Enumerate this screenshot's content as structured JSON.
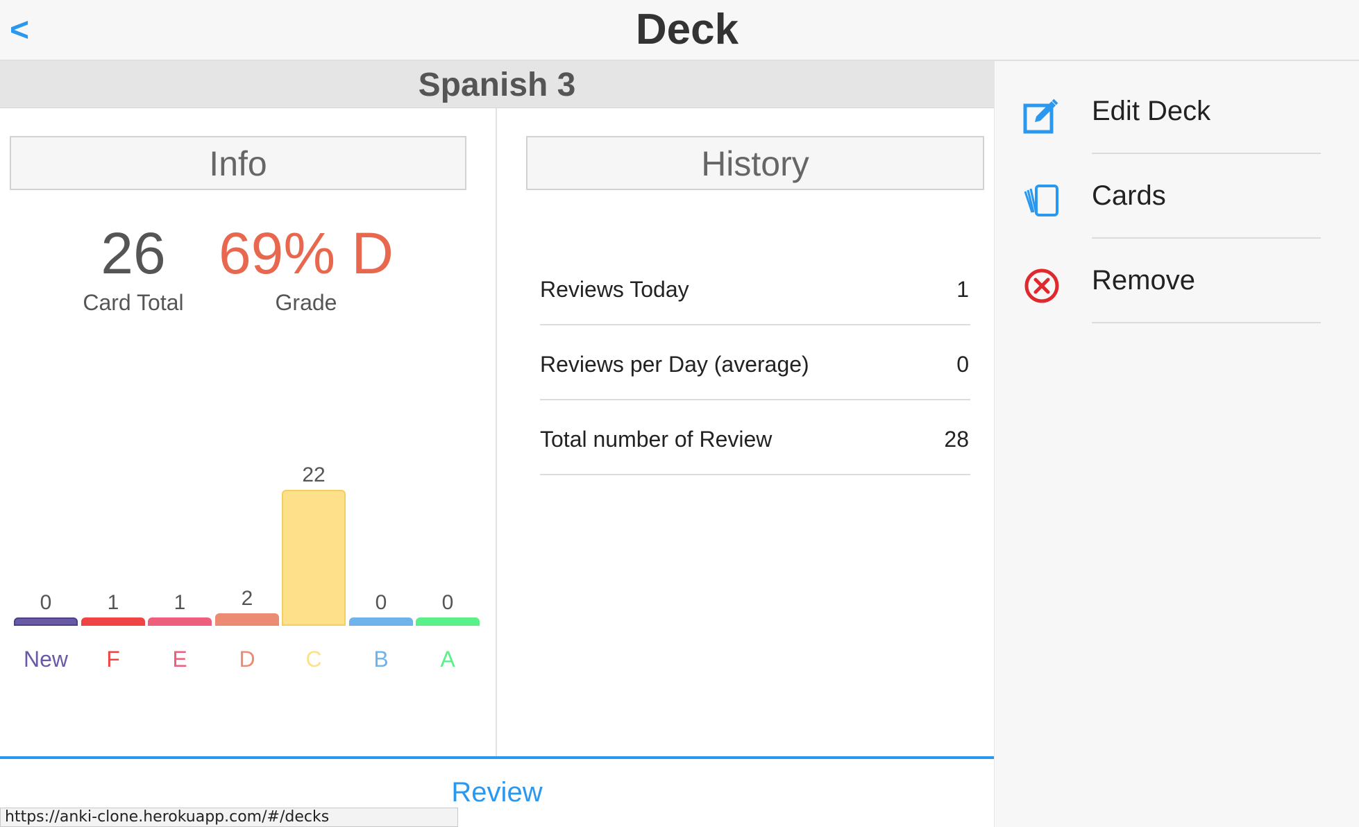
{
  "header": {
    "back_label": "<",
    "title": "Deck"
  },
  "deck": {
    "name": "Spanish 3"
  },
  "info": {
    "heading": "Info",
    "card_total_value": "26",
    "card_total_label": "Card Total",
    "grade_value": "69% D",
    "grade_label": "Grade",
    "grade_color": "#e8684f"
  },
  "chart_data": {
    "type": "bar",
    "categories": [
      "New",
      "F",
      "E",
      "D",
      "C",
      "B",
      "A"
    ],
    "values": [
      0,
      1,
      1,
      2,
      22,
      0,
      0
    ],
    "colors": [
      "#6a5aa6",
      "#ef4444",
      "#ef5e7d",
      "#ec8b74",
      "#ffe08a",
      "#6fb3ea",
      "#5cf08a"
    ],
    "label_colors": [
      "#6a5aa6",
      "#ef4444",
      "#ef5e7d",
      "#ec8b74",
      "#ffe08a",
      "#6fb3ea",
      "#5cf08a"
    ]
  },
  "history": {
    "heading": "History",
    "rows": [
      {
        "label": "Reviews Today",
        "value": "1"
      },
      {
        "label": "Reviews per Day (average)",
        "value": "0"
      },
      {
        "label": "Total number of Review",
        "value": "28"
      }
    ]
  },
  "review": {
    "label": "Review"
  },
  "status_bar": {
    "url": "https://anki-clone.herokuapp.com/#/decks"
  },
  "sidebar": {
    "items": [
      {
        "label": "Edit Deck",
        "icon": "edit-icon",
        "color": "#2b98f0"
      },
      {
        "label": "Cards",
        "icon": "cards-icon",
        "color": "#2b98f0"
      },
      {
        "label": "Remove",
        "icon": "remove-icon",
        "color": "#e0282f"
      }
    ]
  },
  "colors": {
    "accent": "#2b98f0"
  }
}
